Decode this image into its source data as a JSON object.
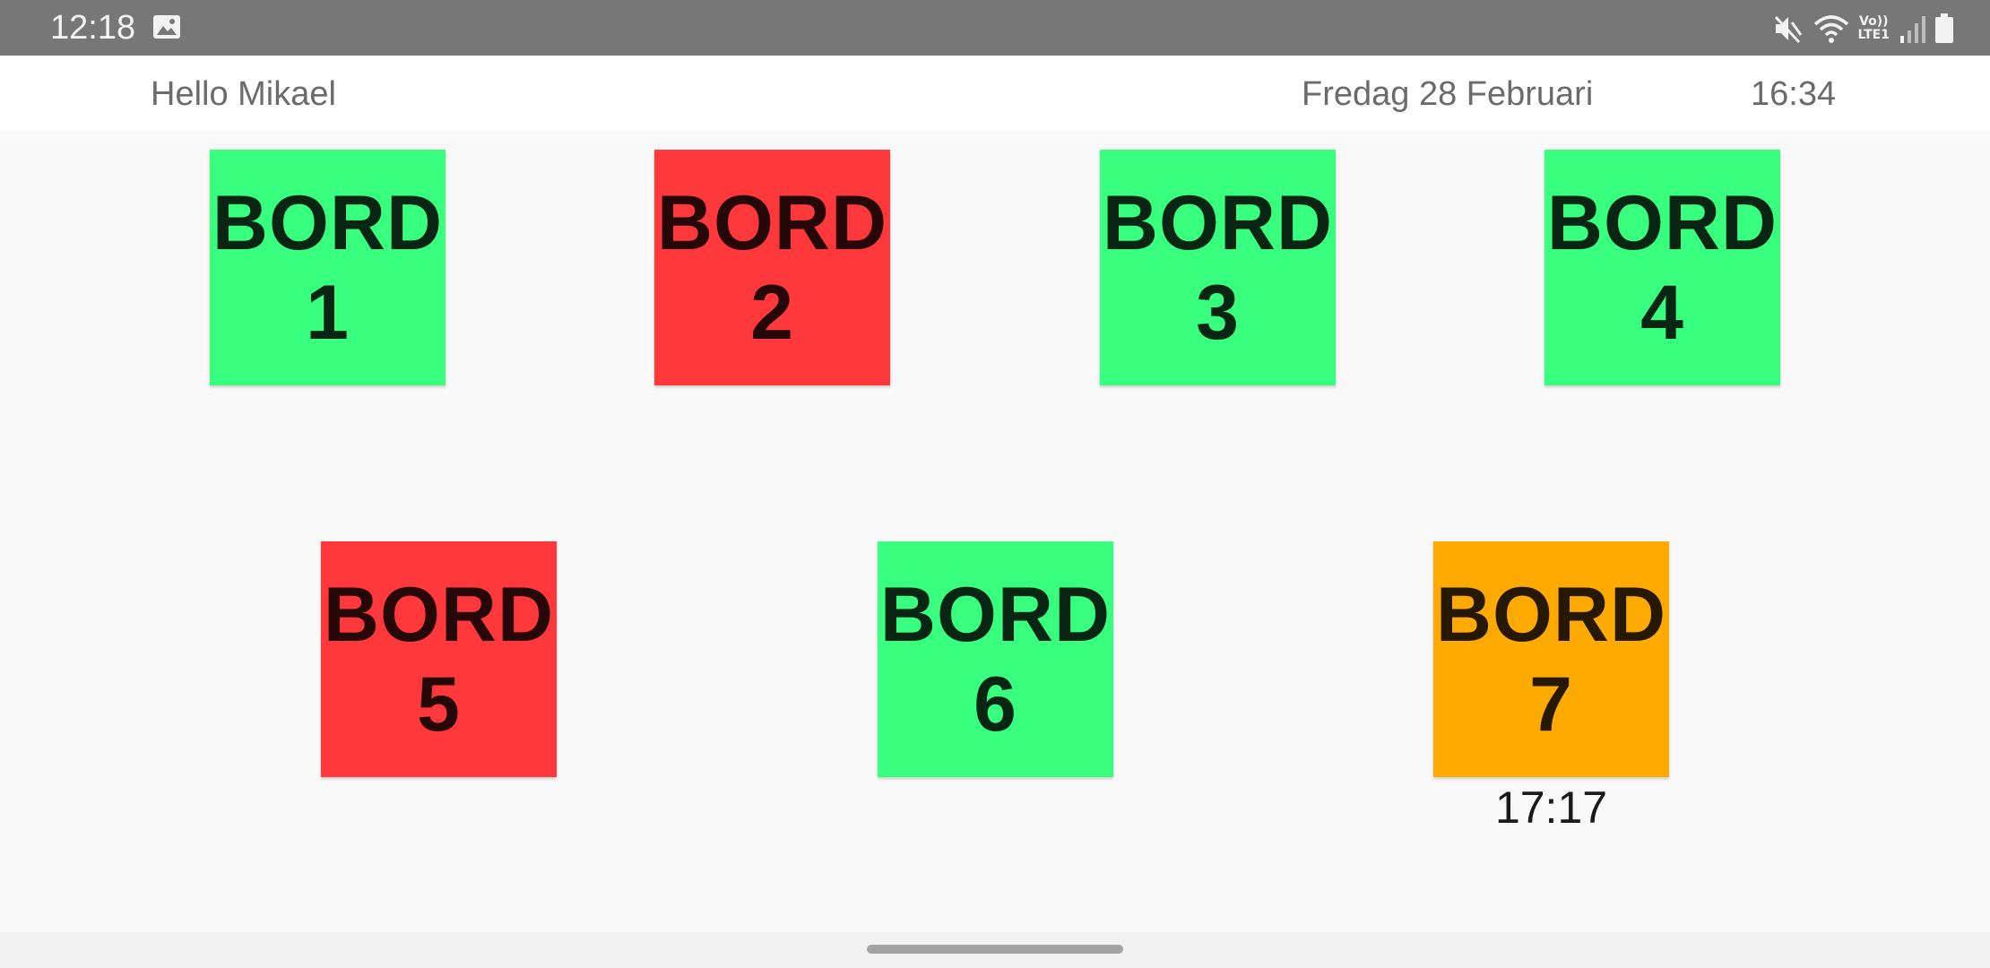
{
  "status_bar": {
    "time": "12:18",
    "icons": [
      "gallery-icon",
      "mute-icon",
      "wifi-icon",
      "volte-icon",
      "signal-icon",
      "battery-icon"
    ],
    "volte_line1": "Vo))",
    "volte_line2": "LTE1"
  },
  "header": {
    "greeting": "Hello Mikael",
    "date": "Fredag 28 Februari",
    "time": "16:34"
  },
  "colors": {
    "available": "#39ff7f",
    "occupied": "#ff383b",
    "reserved": "#ffaa00"
  },
  "tables": [
    {
      "word": "BORD",
      "number": "1",
      "status": "available"
    },
    {
      "word": "BORD",
      "number": "2",
      "status": "occupied"
    },
    {
      "word": "BORD",
      "number": "3",
      "status": "available"
    },
    {
      "word": "BORD",
      "number": "4",
      "status": "available"
    },
    {
      "word": "BORD",
      "number": "5",
      "status": "occupied"
    },
    {
      "word": "BORD",
      "number": "6",
      "status": "available"
    },
    {
      "word": "BORD",
      "number": "7",
      "status": "reserved",
      "time": "17:17"
    }
  ]
}
